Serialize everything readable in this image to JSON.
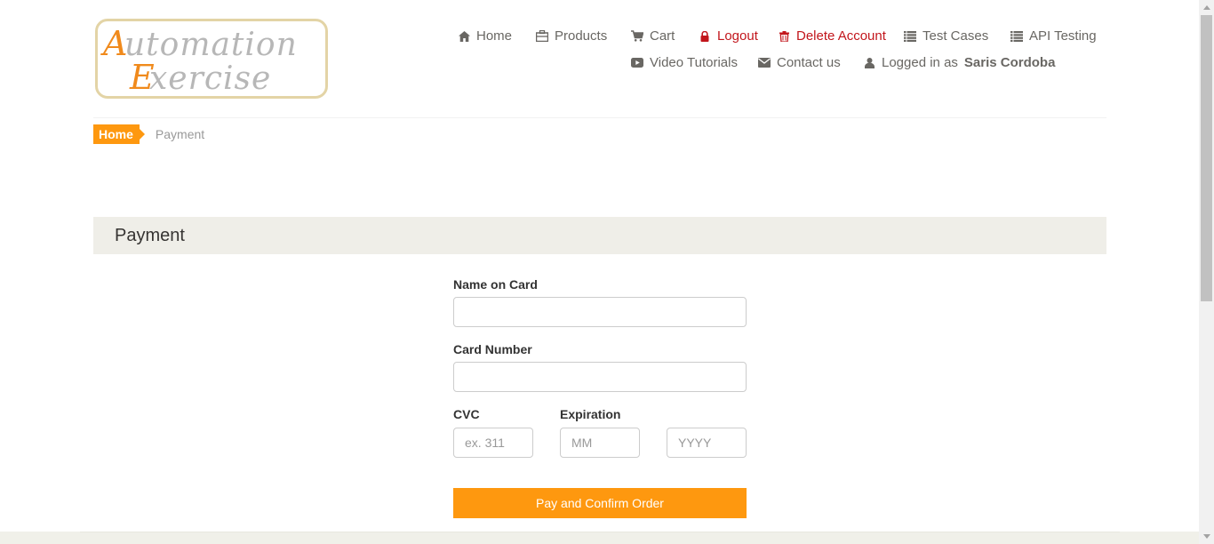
{
  "logo": {
    "line1": "Automation",
    "line2": "Exercise"
  },
  "nav": {
    "home": "Home",
    "products": "Products",
    "cart": "Cart",
    "logout": "Logout",
    "delete_account": "Delete Account",
    "test_cases": "Test Cases",
    "api_testing": "API Testing",
    "video_tutorials": "Video Tutorials",
    "contact_us": "Contact us",
    "logged_in_prefix": "Logged in as",
    "username": "Saris Cordoba"
  },
  "breadcrumb": {
    "home": "Home",
    "current": "Payment"
  },
  "heading": "Payment",
  "form": {
    "name_label": "Name on Card",
    "name_value": "",
    "card_label": "Card Number",
    "card_value": "",
    "cvc_label": "CVC",
    "cvc_placeholder": "ex. 311",
    "expiration_label": "Expiration",
    "month_placeholder": "MM",
    "year_placeholder": "YYYY",
    "submit_label": "Pay and Confirm Order"
  },
  "colors": {
    "accent": "#fe980f",
    "danger": "#c2161c",
    "heading_bg": "#efeee8"
  }
}
